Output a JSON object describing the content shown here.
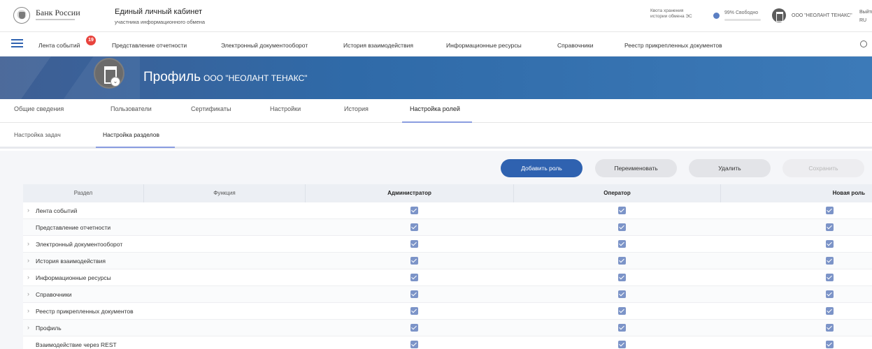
{
  "header": {
    "bank_name": "Банк России",
    "cabinet_title": "Единый личный кабинет",
    "cabinet_subtitle": "участника информационного обмена",
    "quota_line1": "Квота хранения",
    "quota_line2": "истории обмена ЭС",
    "free_text": "99% Свободно",
    "free_percent": 99,
    "org_name": "ООО \"НЕОЛАНТ ТЕНАКС\"",
    "exit_label": "Выйти",
    "lang": "RU"
  },
  "nav": {
    "badge_count": "19",
    "items": [
      "Лента событий",
      "Представление отчетности",
      "Электронный документооборот",
      "История взаимодействия",
      "Информационные ресурсы",
      "Справочники",
      "Реестр прикрепленных документов"
    ]
  },
  "banner": {
    "title": "Профиль",
    "org": "ООО \"НЕОЛАНТ ТЕНАКС\""
  },
  "tabs": [
    "Общие сведения",
    "Пользователи",
    "Сертификаты",
    "Настройки",
    "История",
    "Настройка ролей"
  ],
  "subtabs": [
    "Настройка задач",
    "Настройка разделов"
  ],
  "buttons": {
    "add_role": "Добавить роль",
    "rename": "Переименовать",
    "delete": "Удалить",
    "save": "Сохранить"
  },
  "table": {
    "columns": [
      "Раздел",
      "Функция",
      "Администратор",
      "Оператор",
      "Новая роль"
    ],
    "rows": [
      {
        "label": "Лента событий",
        "expandable": true,
        "admin": true,
        "operator": true,
        "new_role": true
      },
      {
        "label": "Представление отчетности",
        "expandable": false,
        "admin": true,
        "operator": true,
        "new_role": true
      },
      {
        "label": "Электронный документооборот",
        "expandable": true,
        "admin": true,
        "operator": true,
        "new_role": true
      },
      {
        "label": "История взаимодействия",
        "expandable": true,
        "admin": true,
        "operator": true,
        "new_role": true
      },
      {
        "label": "Информационные ресурсы",
        "expandable": true,
        "admin": true,
        "operator": true,
        "new_role": true
      },
      {
        "label": "Справочники",
        "expandable": true,
        "admin": true,
        "operator": true,
        "new_role": true
      },
      {
        "label": "Реестр прикрепленных документов",
        "expandable": true,
        "admin": true,
        "operator": true,
        "new_role": true
      },
      {
        "label": "Профиль",
        "expandable": true,
        "admin": true,
        "operator": true,
        "new_role": true
      },
      {
        "label": "Взаимодействие через REST",
        "expandable": false,
        "admin": true,
        "operator": true,
        "new_role": true
      }
    ]
  },
  "colors": {
    "accent": "#2f62b0",
    "badge": "#e8433d",
    "checkbox": "#7c94c8"
  }
}
